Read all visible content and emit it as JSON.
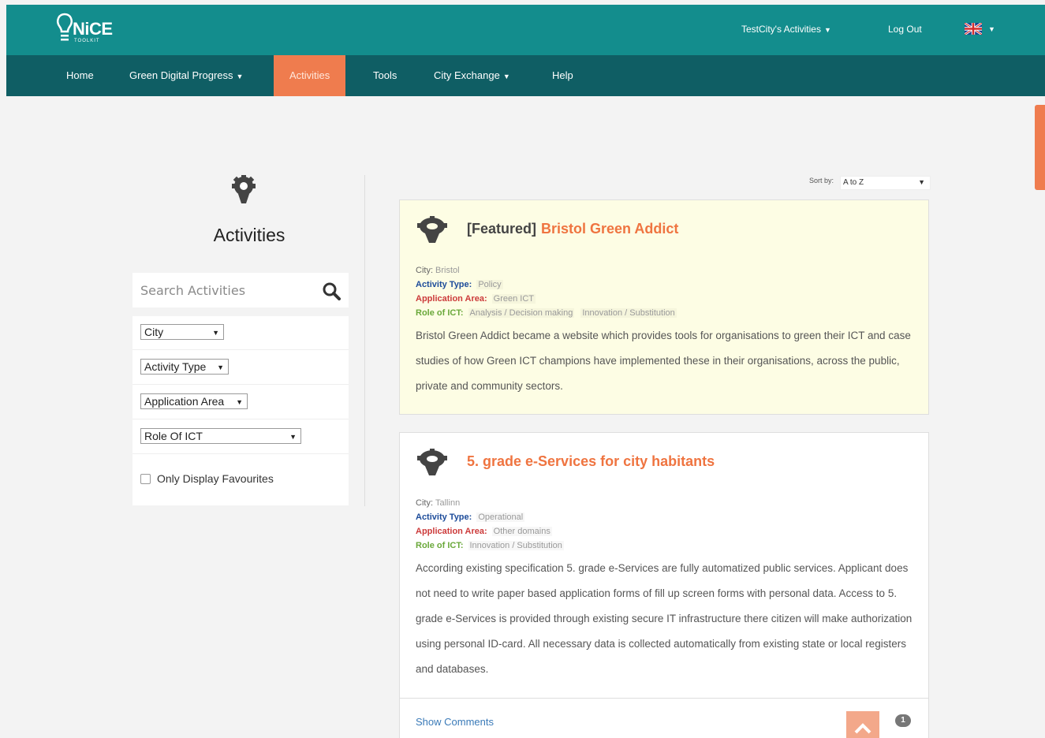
{
  "header": {
    "logo_text": "NiCE",
    "logo_sub": "TOOLKIT",
    "user_menu": "TestCity's Activities",
    "logout": "Log Out"
  },
  "nav": {
    "items": [
      {
        "label": "Home"
      },
      {
        "label": "Green Digital Progress"
      },
      {
        "label": "Activities"
      },
      {
        "label": "Tools"
      },
      {
        "label": "City Exchange"
      },
      {
        "label": "Help"
      }
    ]
  },
  "sidebar": {
    "title": "Activities",
    "search_placeholder": "Search Activities",
    "filters": {
      "city": "City",
      "activity_type": "Activity Type",
      "application_area": "Application Area",
      "role_of_ict": "Role Of ICT"
    },
    "favourites_label": "Only Display Favourites"
  },
  "sort": {
    "label": "Sort by:",
    "value": "A to Z"
  },
  "cards": [
    {
      "featured_label": "[Featured]",
      "title": "Bristol Green Addict",
      "city_label": "City:",
      "city": "Bristol",
      "type_label": "Activity Type:",
      "type": "Policy",
      "area_label": "Application Area:",
      "area": "Green ICT",
      "role_label": "Role of ICT:",
      "roles": [
        "Analysis / Decision making",
        "Innovation / Substitution"
      ],
      "description": "Bristol Green Addict became a website which provides tools for organisations to green their ICT and case studies of how Green ICT champions have implemented these in their organisations, across the public, private and community sectors."
    },
    {
      "title": "5. grade e-Services for city habitants",
      "city_label": "City:",
      "city": "Tallinn",
      "type_label": "Activity Type:",
      "type": "Operational",
      "area_label": "Application Area:",
      "area": "Other domains",
      "role_label": "Role of ICT:",
      "roles": [
        "Innovation / Substitution"
      ],
      "description": "According existing specification 5. grade e-Services are fully automatized public services. Applicant does not need to write paper based application forms of fill up screen forms with personal data. Access to 5. grade e-Services is provided through existing secure IT infrastructure there citizen will make authorization using personal ID-card. All necessary data is collected automatically from existing state or local registers and databases.",
      "show_comments": "Show Comments",
      "comment_count": "1"
    }
  ],
  "colors": {
    "header_bg": "#138d8d",
    "nav_bg": "#0f5e64",
    "accent": "#ef7c4e"
  }
}
